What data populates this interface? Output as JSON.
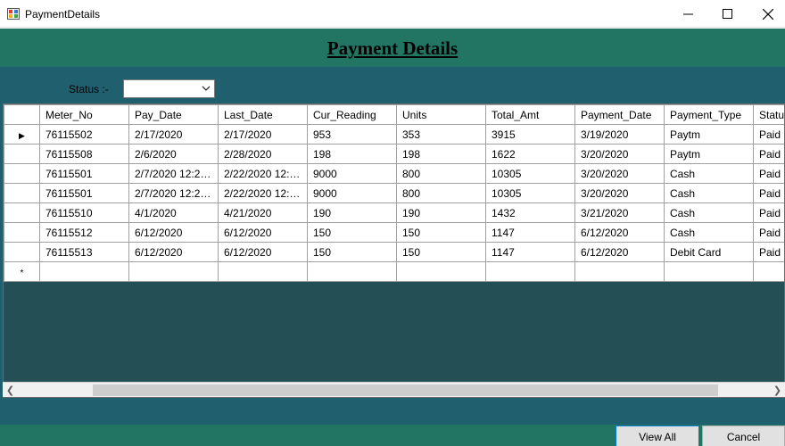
{
  "window": {
    "title": "PaymentDetails"
  },
  "header": {
    "title": "Payment Details"
  },
  "filter": {
    "status_label": "Status :-",
    "status_value": ""
  },
  "grid": {
    "columns": [
      "Meter_No",
      "Pay_Date",
      "Last_Date",
      "Cur_Reading",
      "Units",
      "Total_Amt",
      "Payment_Date",
      "Payment_Type",
      "Status"
    ],
    "rows": [
      [
        "76115502",
        "2/17/2020",
        "2/17/2020",
        "953",
        "353",
        "3915",
        "3/19/2020",
        "Paytm",
        "Paid"
      ],
      [
        "76115508",
        "2/6/2020",
        "2/28/2020",
        "198",
        "198",
        "1622",
        "3/20/2020",
        "Paytm",
        "Paid"
      ],
      [
        "76115501",
        "2/7/2020 12:23 ...",
        "2/22/2020 12:23...",
        "9000",
        "800",
        "10305",
        "3/20/2020",
        "Cash",
        "Paid"
      ],
      [
        "76115501",
        "2/7/2020 12:23 ...",
        "2/22/2020 12:23...",
        "9000",
        "800",
        "10305",
        "3/20/2020",
        "Cash",
        "Paid"
      ],
      [
        "76115510",
        "4/1/2020",
        "4/21/2020",
        "190",
        "190",
        "1432",
        "3/21/2020",
        "Cash",
        "Paid"
      ],
      [
        "76115512",
        "6/12/2020",
        "6/12/2020",
        "150",
        "150",
        "1147",
        "6/12/2020",
        "Cash",
        "Paid"
      ],
      [
        "76115513",
        "6/12/2020",
        "6/12/2020",
        "150",
        "150",
        "1147",
        "6/12/2020",
        "Debit Card",
        "Paid"
      ]
    ],
    "current_row_marker": "▶",
    "new_row_marker": "*"
  },
  "buttons": {
    "view_all": "View All",
    "cancel": "Cancel"
  },
  "colors": {
    "header_band": "#227563",
    "body_band": "#1f5f6e",
    "grid_background": "#234f55"
  }
}
